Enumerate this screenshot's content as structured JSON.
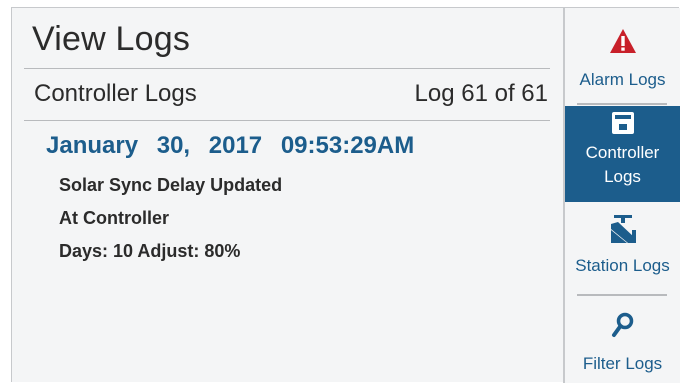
{
  "header": {
    "title": "View Logs"
  },
  "log_view": {
    "subtitle": "Controller Logs",
    "counter": "Log 61 of 61",
    "entry": {
      "date": "January 30, 2017",
      "time": "09:53:29AM",
      "lines": [
        "Solar Sync Delay Updated",
        "At Controller",
        "Days: 10 Adjust: 80%"
      ]
    }
  },
  "sidebar": {
    "items": [
      {
        "label": "Alarm Logs",
        "icon": "alarm-icon",
        "active": false
      },
      {
        "label_line1": "Controller",
        "label_line2": "Logs",
        "icon": "controller-icon",
        "active": true
      },
      {
        "label": "Station Logs",
        "icon": "valve-icon",
        "active": false
      },
      {
        "label": "Filter Logs",
        "icon": "magnifier-icon",
        "active": false
      }
    ]
  },
  "colors": {
    "accent": "#1c5d8c",
    "alarm": "#c8202a",
    "text": "#2b2b2b",
    "background": "#f4f5f6"
  }
}
